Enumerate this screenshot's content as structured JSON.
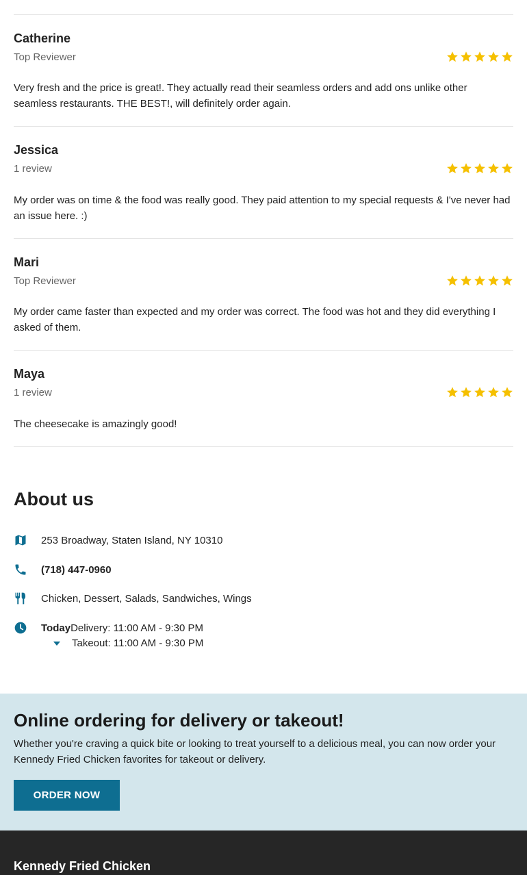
{
  "reviews": [
    {
      "name": "Catherine",
      "subtitle": "Top Reviewer",
      "rating": 5,
      "text": "Very fresh and the price is great!. They actually read their seamless orders and add ons unlike other seamless restaurants. THE BEST!, will definitely order again."
    },
    {
      "name": "Jessica",
      "subtitle": "1 review",
      "rating": 5,
      "text": "My order was on time & the food was really good. They paid attention to my special requests & I've never had an issue here. :)"
    },
    {
      "name": "Mari",
      "subtitle": "Top Reviewer",
      "rating": 5,
      "text": "My order came faster than expected and my order was correct. The food was hot and they did everything I asked of them."
    },
    {
      "name": "Maya",
      "subtitle": "1 review",
      "rating": 5,
      "text": "The cheesecake is amazingly good!"
    }
  ],
  "about": {
    "title": "About us",
    "address": "253 Broadway, Staten Island, NY 10310",
    "phone": "(718) 447-0960",
    "cuisines": "Chicken, Dessert, Salads, Sandwiches, Wings",
    "hours": {
      "day_label": "Today",
      "delivery": "Delivery: 11:00 AM - 9:30 PM",
      "takeout": "Takeout: 11:00 AM - 9:30 PM"
    },
    "icons": {
      "address": "map-icon",
      "phone": "phone-icon",
      "cuisines": "utensils-icon",
      "hours": "clock-icon",
      "expand": "caret-down-icon"
    }
  },
  "promo": {
    "title": "Online ordering for delivery or takeout!",
    "text": "Whether you're craving a quick bite or looking to treat yourself to a delicious meal, you can now order your Kennedy Fried Chicken favorites for takeout or delivery.",
    "button_label": "ORDER NOW"
  },
  "footer": {
    "title": "Kennedy Fried Chicken"
  },
  "colors": {
    "star": "#f5c000",
    "icon": "#0e6e91",
    "promo_bg": "#d3e6ec",
    "button_bg": "#0e6e91",
    "footer_bg": "#262626"
  }
}
